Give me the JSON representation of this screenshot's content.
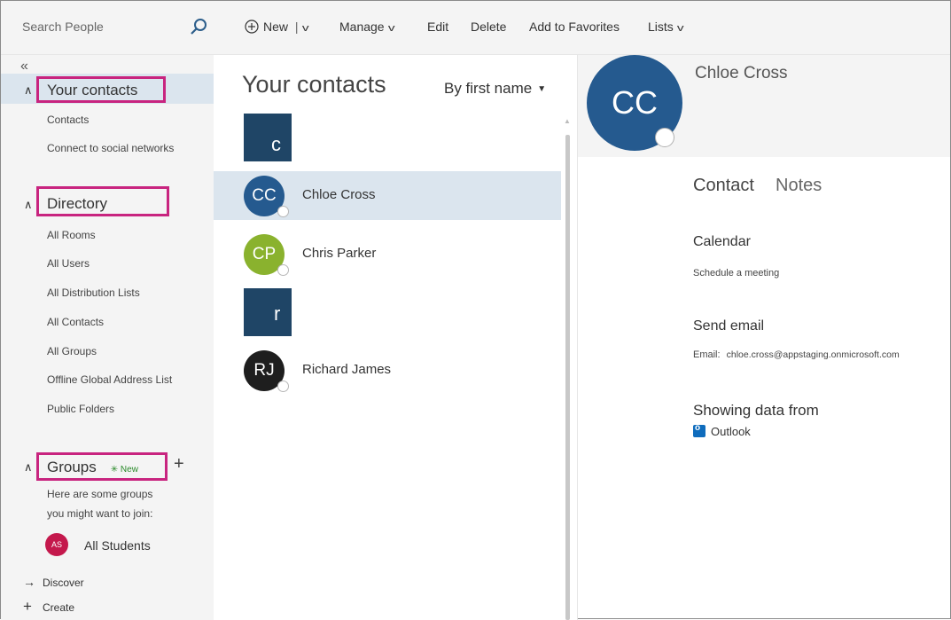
{
  "search": {
    "placeholder": "Search People"
  },
  "toolbar": {
    "new_label": "New",
    "new_divider": "|",
    "manage_label": "Manage",
    "edit_label": "Edit",
    "delete_label": "Delete",
    "favorites_label": "Add to Favorites",
    "lists_label": "Lists"
  },
  "sidebar": {
    "collapse_glyph": "«",
    "your_contacts": {
      "title": "Your contacts",
      "links": [
        "Contacts",
        "Connect to social networks"
      ]
    },
    "directory": {
      "title": "Directory",
      "links": [
        "All Rooms",
        "All Users",
        "All Distribution Lists",
        "All Contacts",
        "All Groups",
        "Offline Global Address List",
        "Public Folders"
      ]
    },
    "groups": {
      "title": "Groups",
      "new_badge": "New",
      "new_star": "✳",
      "add_glyph": "+",
      "suggest_line1": "Here are some groups",
      "suggest_line2": "you might want to join:",
      "suggested_group": {
        "initials": "AS",
        "name": "All Students",
        "color": "#c4184c"
      }
    },
    "footer": {
      "discover_glyph": "→",
      "discover_label": "Discover",
      "create_glyph": "+",
      "create_label": "Create"
    }
  },
  "contact_list": {
    "title": "Your contacts",
    "sort_label": "By first name",
    "letter_c": "c",
    "letter_r": "r",
    "contacts": [
      {
        "initials": "CC",
        "name": "Chloe Cross",
        "color": "#255a8f",
        "selected": true
      },
      {
        "initials": "CP",
        "name": "Chris Parker",
        "color": "#8ab22e",
        "selected": false
      },
      {
        "initials": "RJ",
        "name": "Richard James",
        "color": "#1e1e1e",
        "selected": false
      }
    ]
  },
  "detail": {
    "initials": "CC",
    "name": "Chloe Cross",
    "tab_contact": "Contact",
    "tab_notes": "Notes",
    "calendar_heading": "Calendar",
    "calendar_action": "Schedule a meeting",
    "email_heading": "Send email",
    "email_label": "Email:",
    "email_value": "chloe.cross@appstaging.onmicrosoft.com",
    "source_heading": "Showing data from",
    "source_name": "Outlook"
  },
  "colors": {
    "highlight": "#c8247f",
    "selected_row": "#dbe5ee",
    "tile": "#1f4566"
  }
}
